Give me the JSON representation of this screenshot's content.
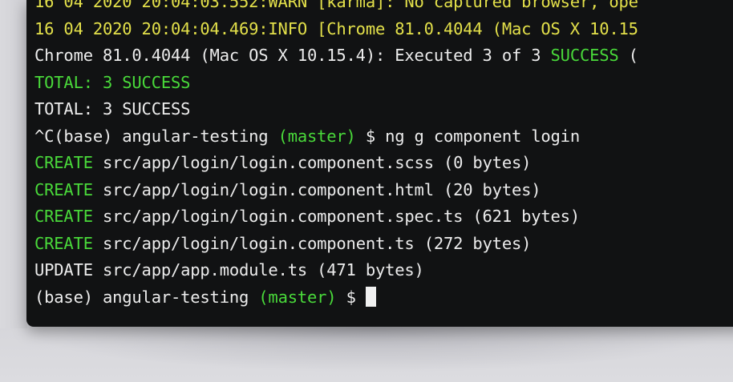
{
  "terminal": {
    "lines": [
      {
        "seg": [
          {
            "t": "16 04 2020 20:04:03.552:WARN [karma]: No captured browser, ope",
            "c": "warn"
          }
        ]
      },
      {
        "seg": [
          {
            "t": "16 04 2020 20:04:04.469:INFO [Chrome 81.0.4044 (Mac OS X 10.15",
            "c": "warn"
          }
        ]
      },
      {
        "seg": [
          {
            "t": "Chrome 81.0.4044 (Mac OS X 10.15.4): Executed 3 of 3 ",
            "c": "white"
          },
          {
            "t": "SUCCESS",
            "c": "green"
          },
          {
            "t": " (",
            "c": "white"
          }
        ]
      },
      {
        "seg": [
          {
            "t": "TOTAL: 3 SUCCESS",
            "c": "green"
          }
        ]
      },
      {
        "seg": [
          {
            "t": "TOTAL: 3 SUCCESS",
            "c": "white"
          }
        ]
      },
      {
        "seg": [
          {
            "t": "^C(base) angular-testing ",
            "c": "white"
          },
          {
            "t": "(master)",
            "c": "green"
          },
          {
            "t": " $ ng g component login",
            "c": "white"
          }
        ]
      },
      {
        "seg": [
          {
            "t": "CREATE",
            "c": "green"
          },
          {
            "t": " src/app/login/login.component.scss (0 bytes)",
            "c": "white"
          }
        ]
      },
      {
        "seg": [
          {
            "t": "CREATE",
            "c": "green"
          },
          {
            "t": " src/app/login/login.component.html (20 bytes)",
            "c": "white"
          }
        ]
      },
      {
        "seg": [
          {
            "t": "CREATE",
            "c": "green"
          },
          {
            "t": " src/app/login/login.component.spec.ts (621 bytes)",
            "c": "white"
          }
        ]
      },
      {
        "seg": [
          {
            "t": "CREATE",
            "c": "green"
          },
          {
            "t": " src/app/login/login.component.ts (272 bytes)",
            "c": "white"
          }
        ]
      },
      {
        "seg": [
          {
            "t": "UPDATE src/app/app.module.ts (471 bytes)",
            "c": "white"
          }
        ]
      },
      {
        "seg": [
          {
            "t": "(base) angular-testing ",
            "c": "white"
          },
          {
            "t": "(master)",
            "c": "green"
          },
          {
            "t": " $ ",
            "c": "white"
          }
        ],
        "cursor": true
      }
    ]
  },
  "colors": {
    "background": "#111213",
    "text": "#ececec",
    "green": "#49d93a",
    "warn": "#e3e04a"
  }
}
